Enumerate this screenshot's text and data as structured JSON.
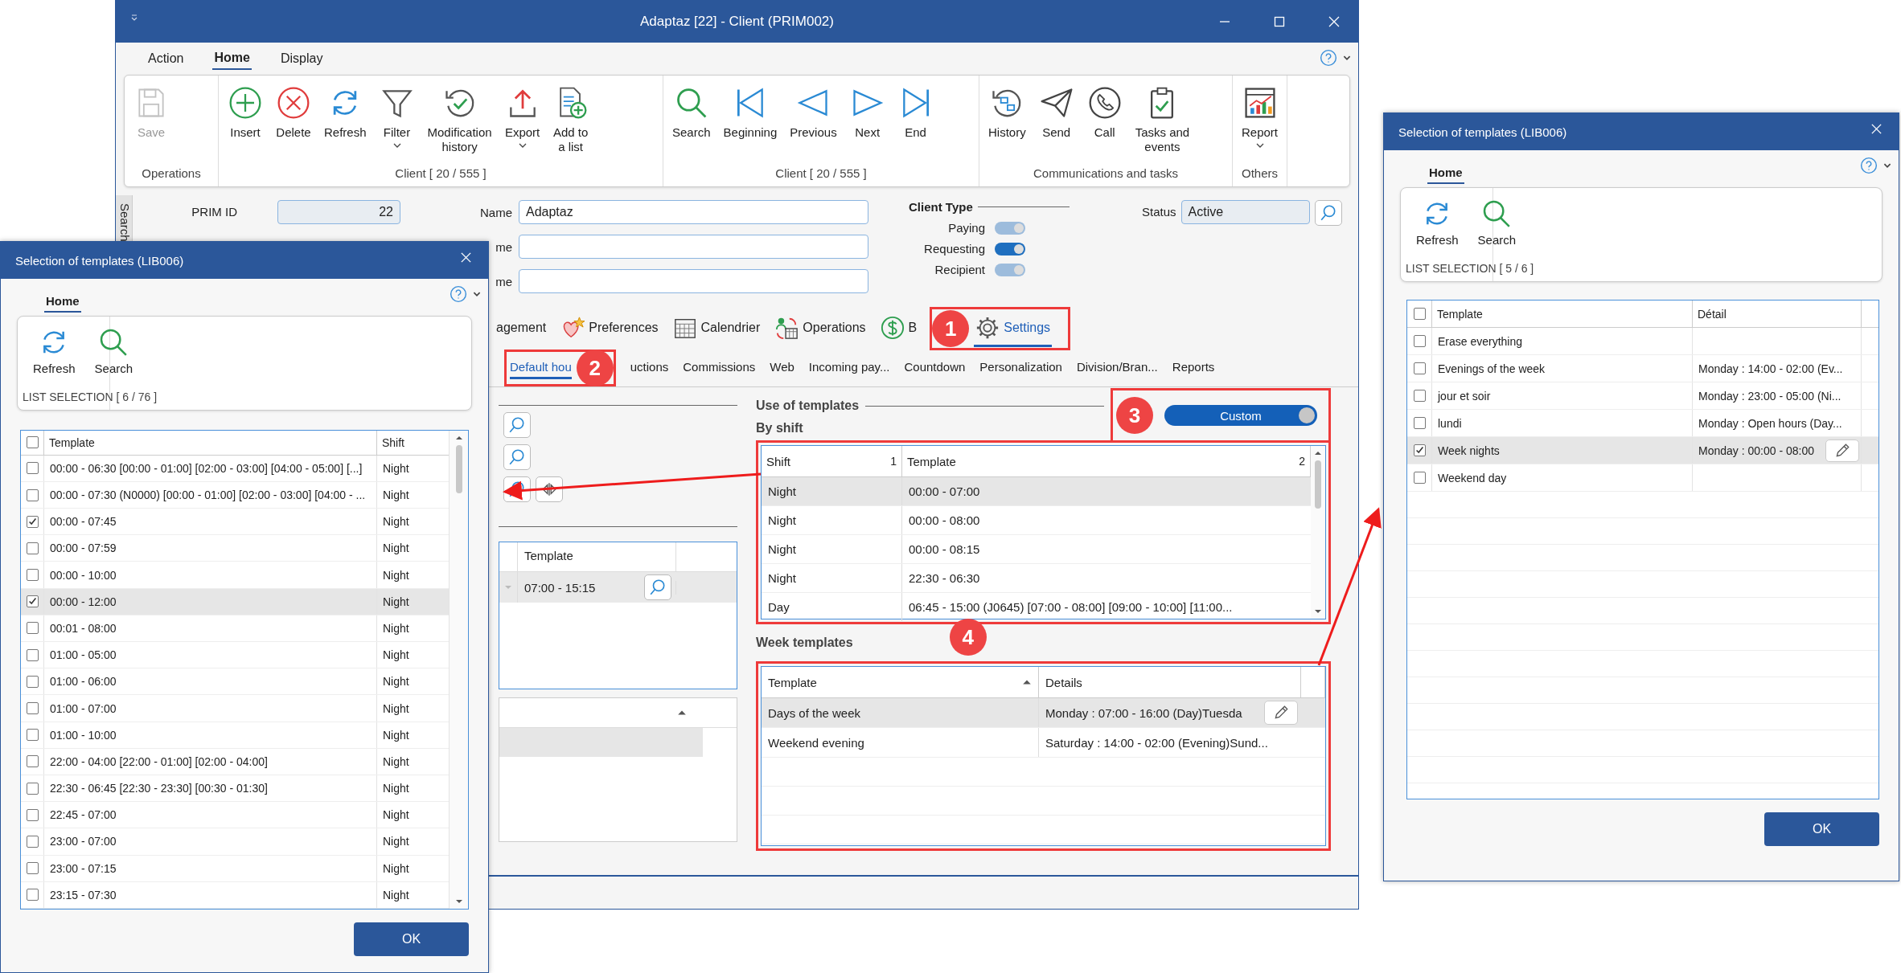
{
  "main_window": {
    "title": "Adaptaz [22] - Client (PRIM002)",
    "menu_tabs": [
      {
        "label": "Action",
        "selected": false
      },
      {
        "label": "Home",
        "selected": true
      },
      {
        "label": "Display",
        "selected": false
      }
    ],
    "ribbon_groups": [
      {
        "label": "Operations",
        "buttons": [
          {
            "label": "Save",
            "kind": "save",
            "disabled": true,
            "dropdown": false
          }
        ]
      },
      {
        "label": "Client [ 20 / 555 ]",
        "buttons": [
          {
            "label": "Insert",
            "kind": "insert",
            "disabled": false,
            "dropdown": false
          },
          {
            "label": "Delete",
            "kind": "delete",
            "disabled": false,
            "dropdown": false
          },
          {
            "label": "Refresh",
            "kind": "refresh",
            "disabled": false,
            "dropdown": false
          },
          {
            "label": "Filter",
            "kind": "filter",
            "disabled": false,
            "dropdown": true
          },
          {
            "label": "Modification\nhistory",
            "kind": "history",
            "disabled": false,
            "dropdown": false
          },
          {
            "label": "Export",
            "kind": "export",
            "disabled": false,
            "dropdown": true
          },
          {
            "label": "Add to\na list",
            "kind": "addlist",
            "disabled": false,
            "dropdown": false
          }
        ]
      },
      {
        "label": "Client [ 20 / 555 ]",
        "buttons": [
          {
            "label": "Search",
            "kind": "search",
            "disabled": false,
            "dropdown": false
          },
          {
            "label": "Beginning",
            "kind": "first",
            "disabled": false,
            "dropdown": false
          },
          {
            "label": "Previous",
            "kind": "prev",
            "disabled": false,
            "dropdown": false
          },
          {
            "label": "Next",
            "kind": "next",
            "disabled": false,
            "dropdown": false
          },
          {
            "label": "End",
            "kind": "last",
            "disabled": false,
            "dropdown": false
          }
        ]
      },
      {
        "label": "Communications and tasks",
        "buttons": [
          {
            "label": "History",
            "kind": "comm",
            "disabled": false,
            "dropdown": false
          },
          {
            "label": "Send",
            "kind": "send",
            "disabled": false,
            "dropdown": false
          },
          {
            "label": "Call",
            "kind": "call",
            "disabled": false,
            "dropdown": false
          },
          {
            "label": "Tasks and\nevents",
            "kind": "tasks",
            "disabled": false,
            "dropdown": false
          }
        ]
      },
      {
        "label": "Others",
        "buttons": [
          {
            "label": "Report",
            "kind": "report",
            "disabled": false,
            "dropdown": true
          }
        ]
      }
    ],
    "side_tab": "Search",
    "form": {
      "prim_id": {
        "label": "PRIM ID",
        "value": "22"
      },
      "name_fields": [
        {
          "label": "Name",
          "value": "Adaptaz"
        },
        {
          "label": "me"
        },
        {
          "label": "me"
        }
      ],
      "client_type": {
        "title": "Client Type",
        "toggles": [
          {
            "label": "Paying",
            "on": true,
            "disabled": true
          },
          {
            "label": "Requesting",
            "on": true,
            "disabled": false
          },
          {
            "label": "Recipient",
            "on": true,
            "disabled": true
          }
        ]
      },
      "status": {
        "label": "Status",
        "value": "Active"
      }
    },
    "tabs": [
      {
        "label": "agement",
        "kind": "plain",
        "selected": false
      },
      {
        "label": "Preferences",
        "kind": "hearts",
        "selected": false
      },
      {
        "label": "Calendrier",
        "kind": "calendar",
        "selected": false
      },
      {
        "label": "Operations",
        "kind": "operations",
        "selected": false
      },
      {
        "label": "B",
        "kind": "dollar",
        "selected": false
      },
      {
        "label": "Settings",
        "kind": "gear",
        "selected": true,
        "callout": "1"
      }
    ],
    "subtabs": [
      {
        "label": "Default hou",
        "selected": true,
        "callout": "2"
      },
      {
        "label": "uctions",
        "selected": false
      },
      {
        "label": "Commissions",
        "selected": false
      },
      {
        "label": "Web",
        "selected": false
      },
      {
        "label": "Incoming pay...",
        "selected": false
      },
      {
        "label": "Countdown",
        "selected": false
      },
      {
        "label": "Personalization",
        "selected": false
      },
      {
        "label": "Division/Bran...",
        "selected": false
      },
      {
        "label": "Reports",
        "selected": false
      }
    ],
    "left_grid": {
      "columns": [
        "Template"
      ],
      "rows": [
        {
          "template": "07:00 - 15:15"
        }
      ]
    },
    "templates": {
      "title": "Use of templates",
      "mode": {
        "label": "Custom",
        "on": true,
        "callout": "3"
      },
      "by_shift": {
        "title": "By shift",
        "highlighted": true,
        "columns": [
          {
            "label": "Shift",
            "sort_index": "1"
          },
          {
            "label": "Template",
            "sort_index": "2"
          }
        ],
        "rows": [
          {
            "shift": "Night",
            "template": "00:00 - 07:00",
            "selected": true
          },
          {
            "shift": "Night",
            "template": "00:00 - 08:00",
            "selected": false
          },
          {
            "shift": "Night",
            "template": "00:00 - 08:15",
            "selected": false
          },
          {
            "shift": "Night",
            "template": "22:30 - 06:30",
            "selected": false
          },
          {
            "shift": "Day",
            "template": "06:45 - 15:00 (J0645) [07:00 - 08:00]  [09:00 - 10:00]  [11:00...",
            "selected": false
          }
        ]
      },
      "week": {
        "title": "Week templates",
        "highlighted": true,
        "callout": "4",
        "columns": [
          {
            "label": "Template",
            "sorted": true
          },
          {
            "label": "Details",
            "sorted": false
          }
        ],
        "rows": [
          {
            "template": "Days of the week",
            "details": "Monday : 07:00 - 16:00 (Day)Tuesda",
            "selected": true,
            "editing": true
          },
          {
            "template": "Weekend evening",
            "details": "Saturday : 14:00 - 02:00 (Evening)Sund...",
            "selected": false,
            "editing": false
          }
        ]
      }
    }
  },
  "left_dialog": {
    "title": "Selection of templates (LIB006)",
    "tabs": [
      {
        "label": "Home",
        "selected": true
      }
    ],
    "buttons": [
      {
        "label": "Refresh",
        "kind": "refresh"
      },
      {
        "label": "Search",
        "kind": "search"
      }
    ],
    "group_label": "LIST SELECTION [ 6 / 76 ]",
    "all_checked": false,
    "columns": [
      "Template",
      "Shift"
    ],
    "rows": [
      {
        "template": "00:00 - 06:30 [00:00 - 01:00]  [02:00 - 03:00]  [04:00 - 05:00] [...]",
        "shift": "Night",
        "checked": false,
        "selected": false
      },
      {
        "template": "00:00 - 07:30 (N0000) [00:00 - 01:00]  [02:00 - 03:00]  [04:00 - ...",
        "shift": "Night",
        "checked": false,
        "selected": false
      },
      {
        "template": "00:00 - 07:45",
        "shift": "Night",
        "checked": true,
        "selected": false
      },
      {
        "template": "00:00 - 07:59",
        "shift": "Night",
        "checked": false,
        "selected": false
      },
      {
        "template": "00:00 - 10:00",
        "shift": "Night",
        "checked": false,
        "selected": false
      },
      {
        "template": "00:00 - 12:00",
        "shift": "Night",
        "checked": true,
        "selected": true
      },
      {
        "template": "00:01 - 08:00",
        "shift": "Night",
        "checked": false,
        "selected": false
      },
      {
        "template": "01:00 - 05:00",
        "shift": "Night",
        "checked": false,
        "selected": false
      },
      {
        "template": "01:00 - 06:00",
        "shift": "Night",
        "checked": false,
        "selected": false
      },
      {
        "template": "01:00 - 07:00",
        "shift": "Night",
        "checked": false,
        "selected": false
      },
      {
        "template": "01:00 - 10:00",
        "shift": "Night",
        "checked": false,
        "selected": false
      },
      {
        "template": "22:00 - 04:00 [22:00 - 01:00]  [02:00 - 04:00]",
        "shift": "Night",
        "checked": false,
        "selected": false
      },
      {
        "template": "22:30 - 06:45 [22:30 - 23:30]  [00:30 - 01:30]",
        "shift": "Night",
        "checked": false,
        "selected": false
      },
      {
        "template": "22:45 - 07:00",
        "shift": "Night",
        "checked": false,
        "selected": false
      },
      {
        "template": "23:00 - 07:00",
        "shift": "Night",
        "checked": false,
        "selected": false
      },
      {
        "template": "23:00 - 07:15",
        "shift": "Night",
        "checked": false,
        "selected": false
      },
      {
        "template": "23:15 - 07:30",
        "shift": "Night",
        "checked": false,
        "selected": false
      }
    ],
    "ok": "OK"
  },
  "right_dialog": {
    "title": "Selection of templates (LIB006)",
    "tabs": [
      {
        "label": "Home",
        "selected": true
      }
    ],
    "buttons": [
      {
        "label": "Refresh",
        "kind": "refresh"
      },
      {
        "label": "Search",
        "kind": "search"
      }
    ],
    "group_label": "LIST SELECTION [ 5 / 6 ]",
    "all_checked": false,
    "columns": [
      "Template",
      "Détail"
    ],
    "rows": [
      {
        "template": "Erase everything",
        "checked": false,
        "selected": false,
        "editing": false
      },
      {
        "template": "Evenings of the week",
        "detail": "Monday : 14:00 - 02:00 (Ev...",
        "checked": false,
        "selected": false,
        "editing": false
      },
      {
        "template": "jour et soir",
        "detail": "Monday : 23:00 - 05:00 (Ni...",
        "checked": false,
        "selected": false,
        "editing": false
      },
      {
        "template": "lundi",
        "detail": "Monday : Open hours (Day...",
        "checked": false,
        "selected": false,
        "editing": false
      },
      {
        "template": "Week nights",
        "detail": "Monday : 00:00 - 08:00",
        "checked": true,
        "selected": true,
        "editing": true
      },
      {
        "template": "Weekend day",
        "checked": false,
        "selected": false,
        "editing": false
      }
    ],
    "ok": "OK"
  }
}
